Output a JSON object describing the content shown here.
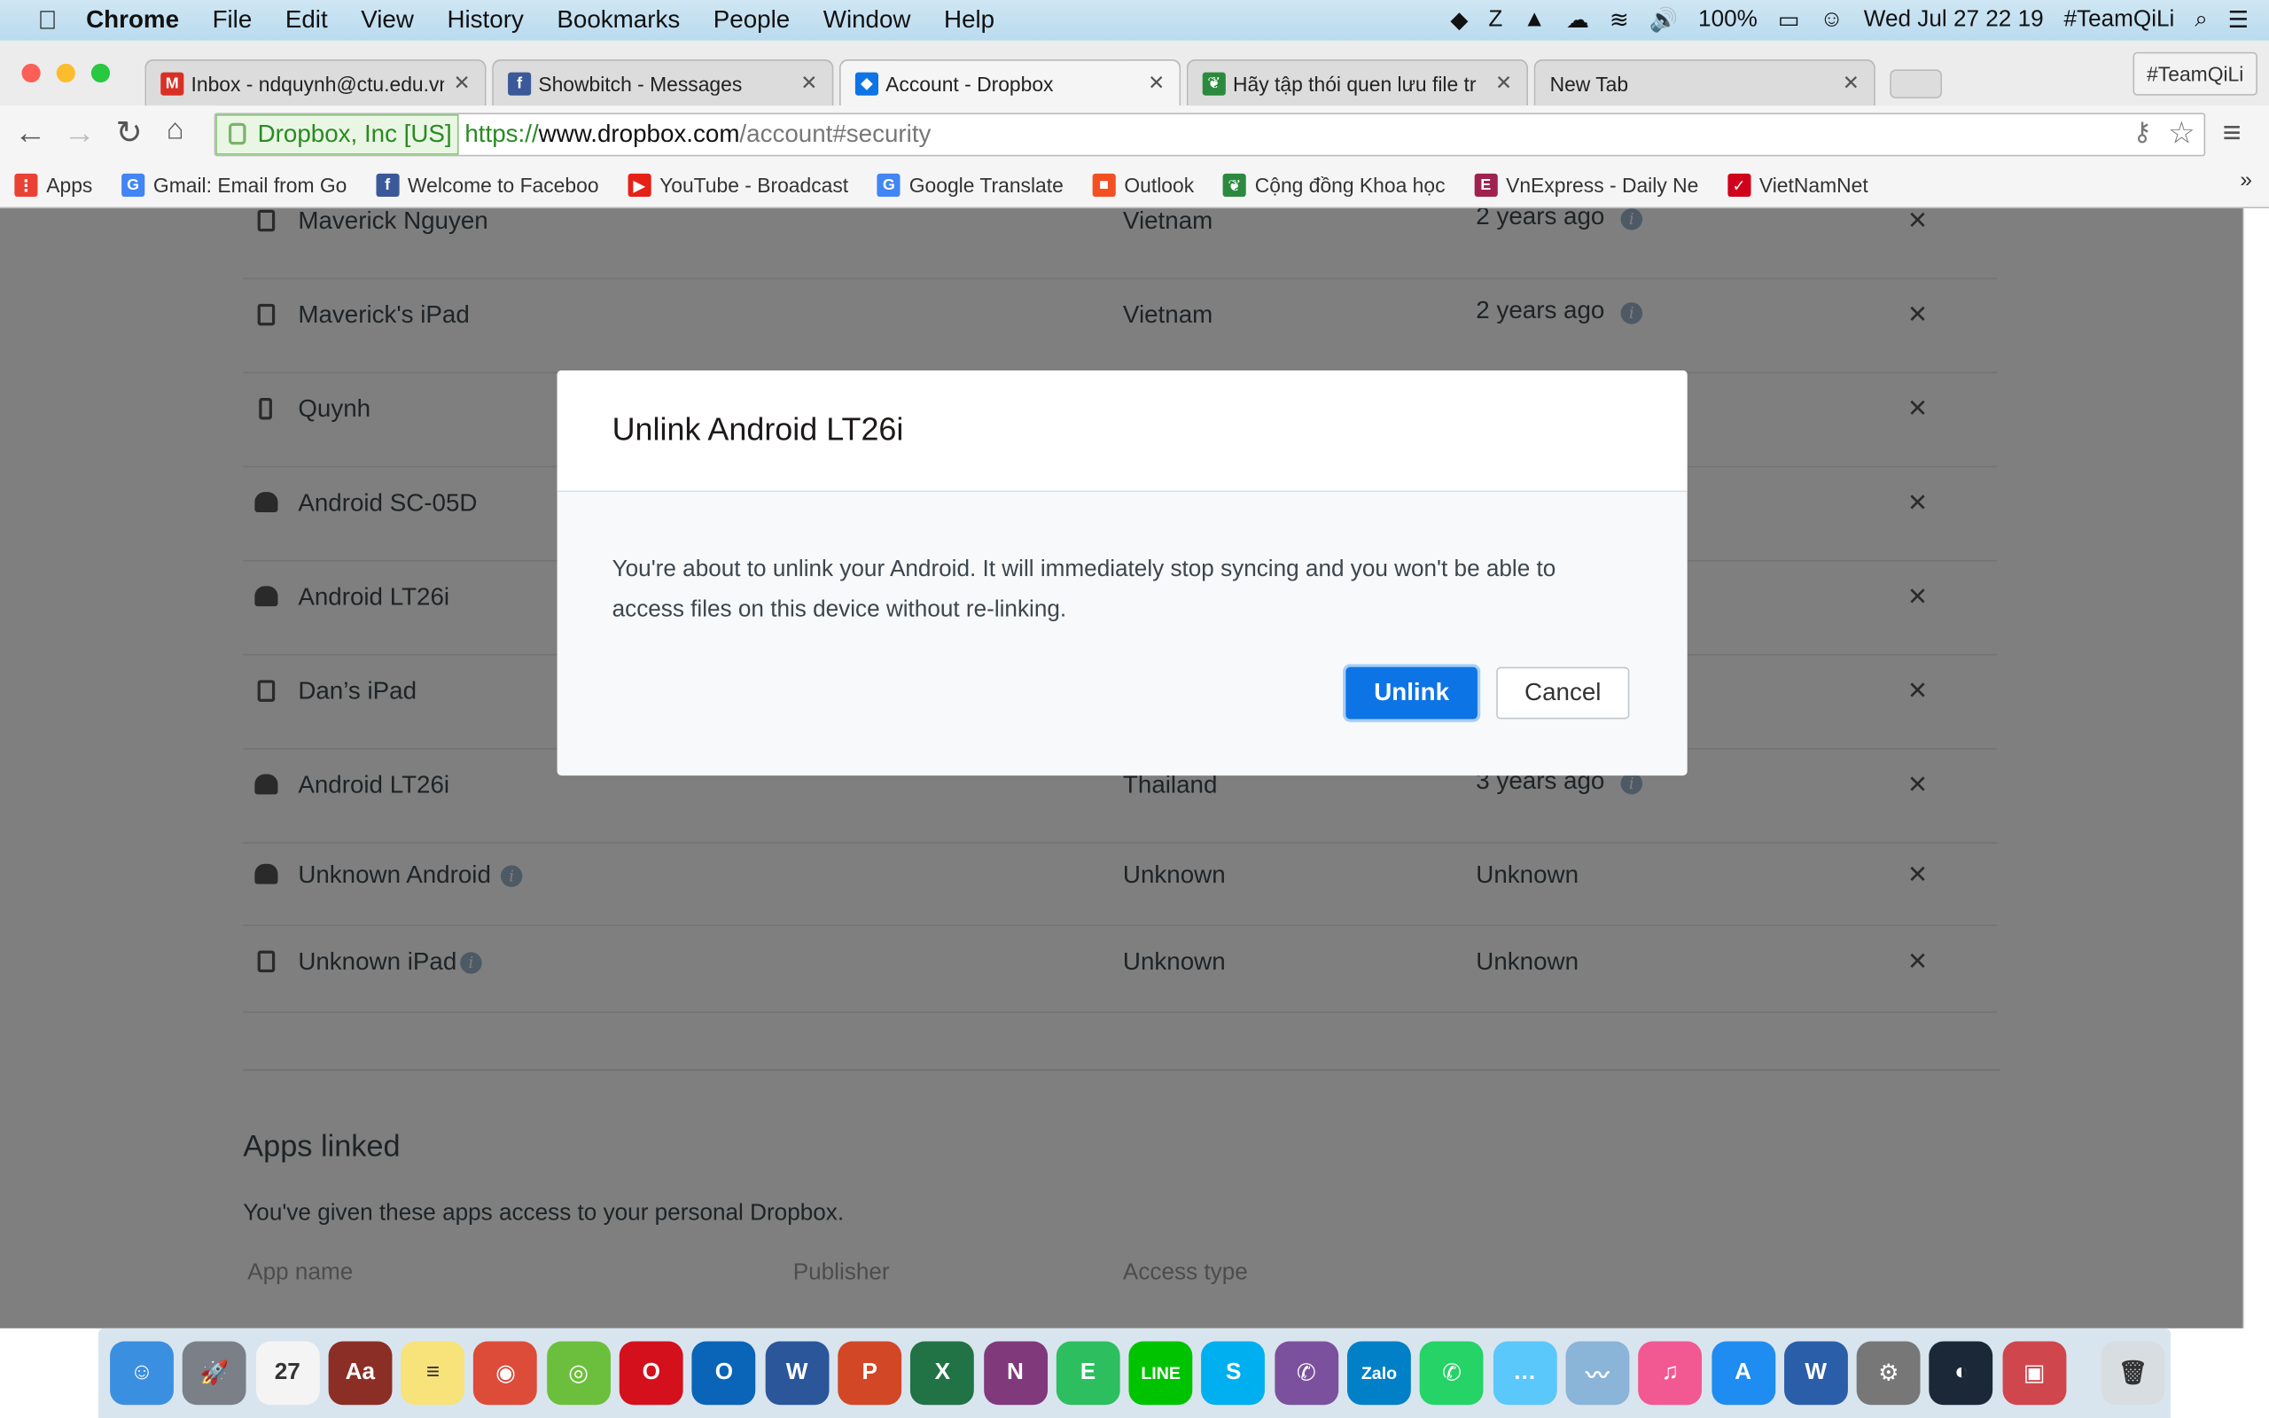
{
  "menubar": {
    "apple": "",
    "app": "Chrome",
    "items": [
      "File",
      "Edit",
      "View",
      "History",
      "Bookmarks",
      "People",
      "Window",
      "Help"
    ],
    "status": {
      "battery": "100%",
      "datetime": "Wed Jul 27  22 19",
      "user": "#TeamQiLi",
      "icons": [
        "dropbox-icon",
        "zalo-icon",
        "google-drive-icon",
        "cloud-icon",
        "wifi-icon",
        "volume-icon",
        "battery-icon",
        "user-icon",
        "search-icon",
        "list-icon"
      ]
    }
  },
  "browser": {
    "tabs": [
      {
        "title": "Inbox - ndquynh@ctu.edu.vn",
        "icon": "gmail-icon",
        "color": "#d93025",
        "glyph": "M"
      },
      {
        "title": "Showbitch - Messages",
        "icon": "facebook-icon",
        "color": "#3b5998",
        "glyph": "f"
      },
      {
        "title": "Account - Dropbox",
        "icon": "dropbox-icon",
        "color": "#0d74e5",
        "glyph": "◆",
        "active": true
      },
      {
        "title": "Hãy tập thói quen lưu file tr",
        "icon": "leaf-icon",
        "color": "#2b8a3e",
        "glyph": "❦"
      },
      {
        "title": "New Tab",
        "icon": "",
        "color": "",
        "glyph": ""
      }
    ],
    "profile": "#TeamQiLi",
    "ev_label": "Dropbox, Inc [US]",
    "url_scheme": "https://",
    "url_host": "www.dropbox.com",
    "url_path": "/account#security",
    "bookmarks": [
      {
        "label": "Apps",
        "color": "#e94235",
        "glyph": "⋮"
      },
      {
        "label": "Gmail: Email from Go",
        "color": "#4285f4",
        "glyph": "G"
      },
      {
        "label": "Welcome to Faceboo",
        "color": "#3b5998",
        "glyph": "f"
      },
      {
        "label": "YouTube - Broadcast",
        "color": "#e62117",
        "glyph": "▶"
      },
      {
        "label": "Google Translate",
        "color": "#4285f4",
        "glyph": "G"
      },
      {
        "label": "Outlook",
        "color": "#f25022",
        "glyph": "■"
      },
      {
        "label": "Cộng đồng Khoa học",
        "color": "#2b8a3e",
        "glyph": "❦"
      },
      {
        "label": "VnExpress - Daily Ne",
        "color": "#9f224e",
        "glyph": "E"
      },
      {
        "label": "VietNamNet",
        "color": "#d0021b",
        "glyph": "✓"
      }
    ],
    "more": "»"
  },
  "devices": [
    {
      "name": "Maverick Nguyen",
      "type": "computer",
      "location": "Vietnam",
      "activity": "2 years ago",
      "info": true
    },
    {
      "name": "Maverick's iPad",
      "type": "tablet",
      "location": "Vietnam",
      "activity": "2 years ago",
      "info": true
    },
    {
      "name": "Quynh",
      "type": "phone",
      "location": "",
      "activity": "",
      "info": false
    },
    {
      "name": "Android SC-05D",
      "type": "android",
      "location": "",
      "activity": "",
      "info": false
    },
    {
      "name": "Android LT26i",
      "type": "android",
      "location": "",
      "activity": "",
      "info": false
    },
    {
      "name": "Dan’s iPad",
      "type": "tablet",
      "location": "",
      "activity": "",
      "info": false
    },
    {
      "name": "Android LT26i",
      "type": "android",
      "location": "Thailand",
      "activity": "3 years ago",
      "info": true
    },
    {
      "name": "Unknown Android",
      "type": "android",
      "location": "Unknown",
      "activity": "Unknown",
      "info": false,
      "name_info": true
    },
    {
      "name": "Unknown iPad",
      "type": "tablet",
      "location": "Unknown",
      "activity": "Unknown",
      "info": false,
      "name_info": true
    }
  ],
  "apps_linked": {
    "title": "Apps linked",
    "description": "You've given these apps access to your personal Dropbox.",
    "columns": [
      "App name",
      "Publisher",
      "Access type"
    ]
  },
  "dialog": {
    "title": "Unlink Android LT26i",
    "body": "You're about to unlink your Android. It will immediately stop syncing and you won't be able to access files on this device without re-linking.",
    "confirm": "Unlink",
    "cancel": "Cancel",
    "accent": "#0d74e5"
  },
  "dock": [
    {
      "name": "finder",
      "color": "#3b8fe0",
      "glyph": "☺"
    },
    {
      "name": "launchpad",
      "color": "#7a7f88",
      "glyph": "🚀"
    },
    {
      "name": "calendar",
      "color": "#f4f4f4",
      "glyph": "27"
    },
    {
      "name": "dictionary",
      "color": "#8b2e25",
      "glyph": "Aa"
    },
    {
      "name": "notes",
      "color": "#f8e27a",
      "glyph": "≡"
    },
    {
      "name": "chrome",
      "color": "#dd4b39",
      "glyph": "◉"
    },
    {
      "name": "coccoc",
      "color": "#6cbf3c",
      "glyph": "◎"
    },
    {
      "name": "opera",
      "color": "#d3101b",
      "glyph": "O"
    },
    {
      "name": "outlook",
      "color": "#0a64b8",
      "glyph": "O"
    },
    {
      "name": "word",
      "color": "#2b579a",
      "glyph": "W"
    },
    {
      "name": "powerpoint",
      "color": "#d24726",
      "glyph": "P"
    },
    {
      "name": "excel",
      "color": "#217346",
      "glyph": "X"
    },
    {
      "name": "onenote",
      "color": "#80397b",
      "glyph": "N"
    },
    {
      "name": "evernote",
      "color": "#2dbe60",
      "glyph": "E"
    },
    {
      "name": "line",
      "color": "#00c300",
      "glyph": "LINE"
    },
    {
      "name": "skype",
      "color": "#00aff0",
      "glyph": "S"
    },
    {
      "name": "viber",
      "color": "#7b519d",
      "glyph": "✆"
    },
    {
      "name": "zalo",
      "color": "#0180c7",
      "glyph": "Zalo"
    },
    {
      "name": "whatsapp",
      "color": "#25d366",
      "glyph": "✆"
    },
    {
      "name": "messages",
      "color": "#5ac8fa",
      "glyph": "…"
    },
    {
      "name": "wunderbucket",
      "color": "#8ab4d8",
      "glyph": "〰"
    },
    {
      "name": "itunes",
      "color": "#f25891",
      "glyph": "♫"
    },
    {
      "name": "app-store",
      "color": "#1e8cf0",
      "glyph": "A"
    },
    {
      "name": "wps",
      "color": "#2b5ea8",
      "glyph": "W"
    },
    {
      "name": "system-preferences",
      "color": "#777",
      "glyph": "⚙"
    },
    {
      "name": "steam",
      "color": "#1b2838",
      "glyph": "◐"
    },
    {
      "name": "photo-booth",
      "color": "#d0464d",
      "glyph": "▣"
    },
    {
      "name": "trash",
      "color": "#d8dde2",
      "glyph": "🗑"
    }
  ]
}
